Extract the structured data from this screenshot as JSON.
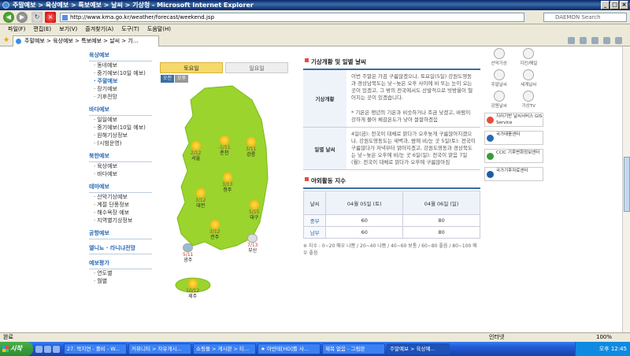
{
  "window": {
    "title": "주말예보 > 육상예보 > 특보예보 > 날씨 > 기상청 - Microsoft Internet Explorer",
    "min": "_",
    "max": "□",
    "close": "×"
  },
  "address": {
    "url": "http://www.kma.go.kr/weather/forecast/weekend.jsp",
    "search_placeholder": "DAEMON Search"
  },
  "menu": [
    "파일(F)",
    "편집(E)",
    "보기(V)",
    "즐겨찾기(A)",
    "도구(T)",
    "도움말(H)"
  ],
  "tab": {
    "label": "주말예보 > 육상예보 > 특보예보 > 날씨 > 기..."
  },
  "leftnav": {
    "sections": [
      {
        "title": "육상예보",
        "items": [
          "동네예보",
          "중기예보(10일 예보)",
          "주말예보",
          "장기예보",
          "기후전망"
        ]
      },
      {
        "title": "바다예보",
        "items": [
          "일일예보",
          "중기예보(10일 예보)",
          "원해기상정보",
          "(시범운영)"
        ]
      },
      {
        "title": "북한예보",
        "items": [
          "육상예보",
          "바다예보"
        ]
      },
      {
        "title": "테마예보",
        "items": [
          "산악기상예보",
          "계절 단풍정보",
          "해수욕장 예보",
          "지역별기상정보"
        ]
      },
      {
        "title": "공항예보",
        "items": []
      },
      {
        "title": "엘니뇨 · 라니냐전망",
        "items": []
      },
      {
        "title": "예보평가",
        "items": [
          "연도별",
          "월별"
        ]
      }
    ]
  },
  "map": {
    "tab_sat": "토요일",
    "tab_sun": "일요일",
    "am": "오전",
    "pm": "오후",
    "cities": [
      {
        "name": "서울",
        "temp": "2/12",
        "icon": "sun-cloud-icon"
      },
      {
        "name": "춘천",
        "temp": "-1/11",
        "icon": "sun-icon"
      },
      {
        "name": "강릉",
        "temp": "3/11",
        "icon": "sun-icon"
      },
      {
        "name": "청주",
        "temp": "3/13",
        "icon": "sun-cloud-icon"
      },
      {
        "name": "대전",
        "temp": "3/12",
        "icon": "sun-cloud-icon"
      },
      {
        "name": "대구",
        "temp": "5/15",
        "icon": "sun-icon"
      },
      {
        "name": "전주",
        "temp": "3/12",
        "icon": "sun-cloud-icon"
      },
      {
        "name": "광주",
        "temp": "5/11",
        "icon": "rain-icon"
      },
      {
        "name": "부산",
        "temp": "7/13",
        "icon": "cloud-icon"
      },
      {
        "name": "제주",
        "temp": "10/12",
        "icon": "sun-cloud-icon"
      }
    ]
  },
  "info": {
    "title": "기상개황 및 일별 날씨",
    "overview_label": "기상개황",
    "overview_text": "이번 주말은 가끔 구름많겠으나, 토요일(5일) 강원도영동과 경상남북도는 낮~늦은 오후 사이에 비 또는 눈이 오는 곳이 있겠고, 그 밖의 전국에서도 산발적으로 빗방울이 떨어지는 곳이 있겠습니다.",
    "overview_text2": "* 기온은 평년의 기온과 비슷하거나 조금 낮겠고, 바람이 강하게 불어 체감온도가 낮아 쌀쌀하겠음",
    "daily_label": "일별 날씨",
    "daily_text": "4일(금): 전국이 대체로 맑다가 오후늦게 구름많아지겠으나, 강원도영동도는 새벽과, 밤에 비/눈 곳 5일(토): 전국이 구름많다가 저녁부터 맑아지겠고, 강원도영동과 경상북도는 낮~늦은 오후에 비/눈 곳 6일(일): 전국이 맑음 7일(월): 전국이 대체로 맑다가 오후에 구름많아짐",
    "activity_title": "야외활동 지수",
    "activity": {
      "col_region": "날씨",
      "col_sat": "04월 05일 (토)",
      "col_sun": "04월 06일 (일)",
      "rows": [
        {
          "region": "중부",
          "sat": "60",
          "sun": "80"
        },
        {
          "region": "남부",
          "sat": "60",
          "sun": "80"
        }
      ]
    },
    "note": "※ 지수 : 0~20 매우 나쁨 / 20~40 나쁨 / 40~60 보통 / 60~80 좋음 / 80~100 매우 좋음"
  },
  "rightcol": {
    "icons": [
      "산악기상",
      "지진/해일",
      "주말날씨",
      "세계날씨",
      "강원날씨",
      "기상TV"
    ],
    "banners": [
      "지리기반 날씨서비스 GIS Service",
      "국가태풍센터",
      "CCIC 기후변화정보센터",
      "국가기후자료센터"
    ]
  },
  "status": {
    "left": "완료",
    "internet": "인터넷",
    "zoom": "100%"
  },
  "taskbar": {
    "start": "시작",
    "tasks": [
      "27. 박지연 - 롤비 - W...",
      "커뮤니티 > 자유게시...",
      "쇼핑몰 > 게시판 > 티...",
      "★ 아반테[HD]를 사...",
      "제목 없음 - 그림판",
      "주말예보 > 육상예..."
    ],
    "clock": "오후 12:45"
  }
}
